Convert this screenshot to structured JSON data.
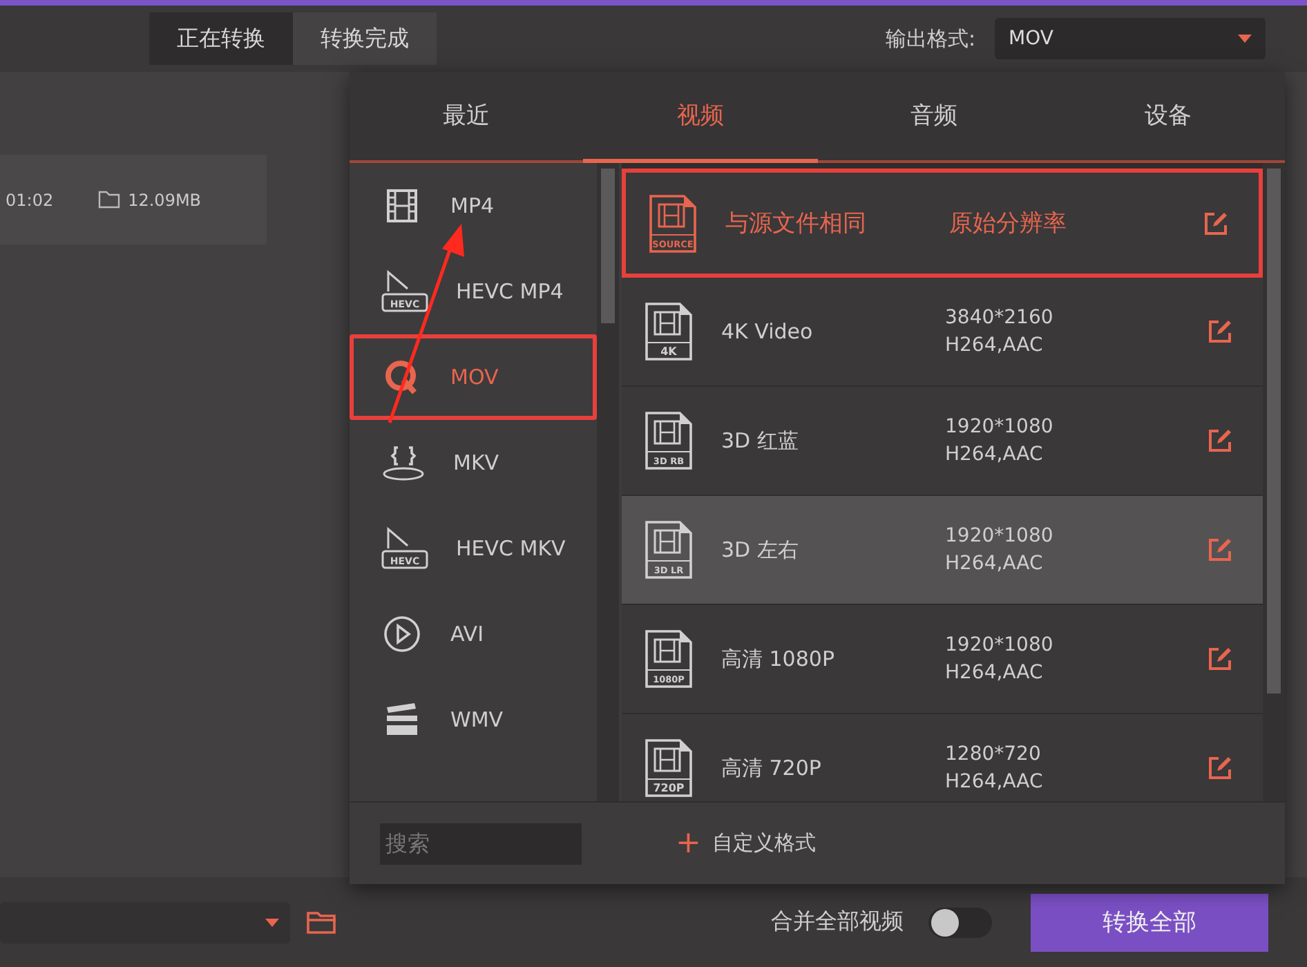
{
  "top_tabs": [
    {
      "label": "正在转换",
      "selected": true
    },
    {
      "label": "转换完成",
      "selected": false
    }
  ],
  "output_format": {
    "label": "输出格式:",
    "value": "MOV"
  },
  "file_row": {
    "duration": "01:02",
    "size": "12.09MB"
  },
  "popup": {
    "tabs": [
      {
        "label": "最近",
        "selected": false
      },
      {
        "label": "视频",
        "selected": true
      },
      {
        "label": "音频",
        "selected": false
      },
      {
        "label": "设备",
        "selected": false
      }
    ],
    "formats": [
      {
        "label": "MP4",
        "kind": "film",
        "selected": false,
        "annotated": false
      },
      {
        "label": "HEVC MP4",
        "kind": "hevc",
        "badge": "HEVC",
        "selected": false,
        "annotated": false
      },
      {
        "label": "MOV",
        "kind": "quicktime",
        "selected": true,
        "annotated": true
      },
      {
        "label": "MKV",
        "kind": "braces",
        "selected": false,
        "annotated": false
      },
      {
        "label": "HEVC MKV",
        "kind": "hevc",
        "badge": "HEVC",
        "selected": false,
        "annotated": false
      },
      {
        "label": "AVI",
        "kind": "play",
        "selected": false,
        "annotated": false
      },
      {
        "label": "WMV",
        "kind": "clapper",
        "selected": false,
        "annotated": false
      }
    ],
    "presets": [
      {
        "name": "与源文件相同",
        "badge": "SOURCE",
        "resolution": "原始分辨率",
        "selected": true,
        "hovered": false,
        "annotated": true
      },
      {
        "name": "4K Video",
        "badge": "4K",
        "resolution": "3840*2160",
        "codec": "H264,AAC",
        "selected": false,
        "hovered": false,
        "annotated": false
      },
      {
        "name": "3D 红蓝",
        "badge": "3D RB",
        "resolution": "1920*1080",
        "codec": "H264,AAC",
        "selected": false,
        "hovered": false,
        "annotated": false
      },
      {
        "name": "3D 左右",
        "badge": "3D LR",
        "resolution": "1920*1080",
        "codec": "H264,AAC",
        "selected": false,
        "hovered": true,
        "annotated": false
      },
      {
        "name": "高清 1080P",
        "badge": "1080P",
        "resolution": "1920*1080",
        "codec": "H264,AAC",
        "selected": false,
        "hovered": false,
        "annotated": false
      },
      {
        "name": "高清 720P",
        "badge": "720P",
        "resolution": "1280*720",
        "codec": "H264,AAC",
        "selected": false,
        "hovered": false,
        "annotated": false
      }
    ],
    "search": {
      "placeholder": "搜索"
    },
    "custom_format": {
      "icon": "+",
      "label": "自定义格式"
    }
  },
  "bottom": {
    "merge_label": "合并全部视频",
    "merge_on": false,
    "convert_all": "转换全部"
  }
}
